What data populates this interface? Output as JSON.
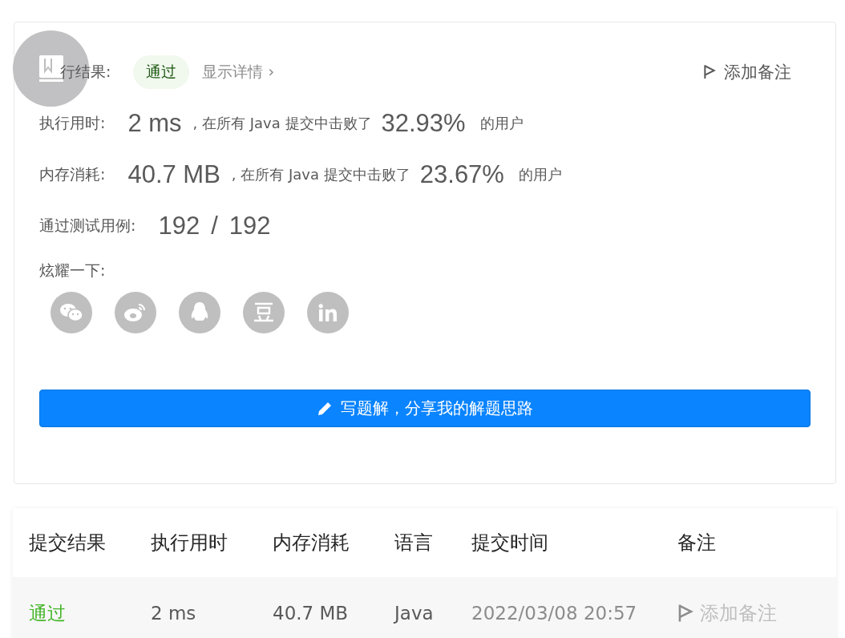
{
  "result": {
    "label": "行结果:",
    "status": "通过",
    "details_link": "显示详情",
    "details_arrow": "›",
    "add_note": "添加备注"
  },
  "stats": [
    {
      "label": "执行用时:",
      "value": "2 ms",
      "middle": ", 在所有 Java 提交中击败了",
      "percent": "32.93%",
      "suffix": "的用户"
    },
    {
      "label": "内存消耗:",
      "value": "40.7 MB",
      "middle": ", 在所有 Java 提交中击败了",
      "percent": "23.67%",
      "suffix": "的用户"
    }
  ],
  "testcases": {
    "label": "通过测试用例:",
    "passed": "192",
    "separator": "/",
    "total": "192"
  },
  "share": {
    "label": "炫耀一下:",
    "icons": [
      {
        "kind": "wechat"
      },
      {
        "kind": "weibo"
      },
      {
        "kind": "qq"
      },
      {
        "kind": "douban"
      },
      {
        "kind": "linkedin"
      }
    ]
  },
  "write_button": "写题解，分享我的解题思路",
  "table": {
    "columns": [
      "提交结果",
      "执行用时",
      "内存消耗",
      "语言",
      "提交时间",
      "备注"
    ],
    "rows": [
      {
        "result": "通过",
        "time": "2 ms",
        "memory": "40.7 MB",
        "language": "Java",
        "submitted": "2022/03/08 20:57",
        "note": "添加备注"
      }
    ]
  }
}
